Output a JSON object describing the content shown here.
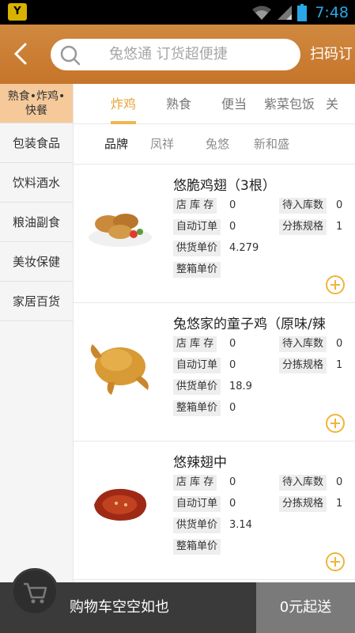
{
  "status_bar": {
    "time": "7:48"
  },
  "header": {
    "search_placeholder": "兔悠通  订货超便捷",
    "scan_label": "扫码订"
  },
  "sidebar": {
    "items": [
      {
        "label": "熟食•炸鸡•快餐"
      },
      {
        "label": "包装食品"
      },
      {
        "label": "饮料酒水"
      },
      {
        "label": "粮油副食"
      },
      {
        "label": "美妆保健"
      },
      {
        "label": "家居百货"
      }
    ]
  },
  "tabs": [
    "炸鸡",
    "熟食",
    "便当",
    "紫菜包饭",
    "关"
  ],
  "brands": [
    "品牌",
    "凤祥",
    "兔悠",
    "新和盛"
  ],
  "field_labels": {
    "stock": "店 库 存",
    "pending": "待入库数",
    "auto_order": "自动订单",
    "spec": "分拣规格",
    "unit_price": "供货单价",
    "box_price": "整箱单价"
  },
  "products": [
    {
      "name": "悠脆鸡翅（3根）",
      "stock": "0",
      "pending": "0",
      "auto_order": "0",
      "spec": "1",
      "unit_price": "4.279",
      "box_price": ""
    },
    {
      "name": "兔悠家的童子鸡（原味/辣",
      "stock": "0",
      "pending": "0",
      "auto_order": "0",
      "spec": "1",
      "unit_price": "18.9",
      "box_price": "0"
    },
    {
      "name": "悠辣翅中",
      "stock": "0",
      "pending": "0",
      "auto_order": "0",
      "spec": "1",
      "unit_price": "3.14",
      "box_price": ""
    }
  ],
  "cart": {
    "text": "购物车空空如也",
    "checkout_label": "0元起送"
  },
  "colors": {
    "header": "#c97b30",
    "accent": "#f0b43a",
    "sidebar_active": "#f6c99b",
    "bottom_bar": "#3a3a3a"
  }
}
